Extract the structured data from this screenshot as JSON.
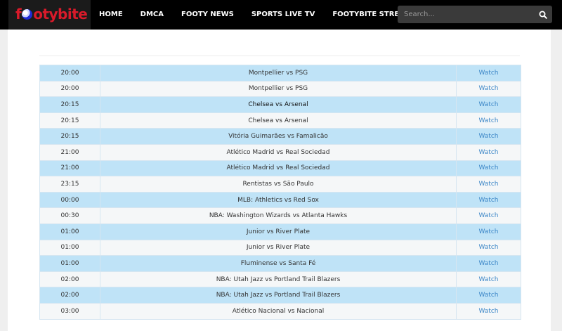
{
  "header": {
    "logo_text_prefix": "f",
    "logo_text_suffix": "otybite",
    "nav": [
      "HOME",
      "DMCA",
      "FOOTY NEWS",
      "SPORTS LIVE TV",
      "FOOTYBITE STREAM"
    ],
    "search_placeholder": "Search...",
    "colors": {
      "logo": "#d91a2a",
      "bar": "#000000"
    }
  },
  "schedule": {
    "watch_label": "Watch",
    "rows": [
      {
        "time": "20:00",
        "match": "Montpellier vs PSG"
      },
      {
        "time": "20:00",
        "match": "Montpellier vs PSG"
      },
      {
        "time": "20:15",
        "match": "Chelsea vs Arsenal"
      },
      {
        "time": "20:15",
        "match": "Chelsea vs Arsenal"
      },
      {
        "time": "20:15",
        "match": "Vitória Guimarães vs Famalicão"
      },
      {
        "time": "21:00",
        "match": "Atlético Madrid vs Real Sociedad"
      },
      {
        "time": "21:00",
        "match": "Atlético Madrid vs Real Sociedad"
      },
      {
        "time": "23:15",
        "match": "Rentistas vs São Paulo"
      },
      {
        "time": "00:00",
        "match": "MLB: Athletics vs Red Sox"
      },
      {
        "time": "00:30",
        "match": "NBA: Washington Wizards vs Atlanta Hawks"
      },
      {
        "time": "01:00",
        "match": "Junior vs River Plate"
      },
      {
        "time": "01:00",
        "match": "Junior vs River Plate"
      },
      {
        "time": "01:00",
        "match": "Fluminense vs Santa Fé"
      },
      {
        "time": "02:00",
        "match": "NBA: Utah Jazz vs Portland Trail Blazers"
      },
      {
        "time": "02:00",
        "match": "NBA: Utah Jazz vs Portland Trail Blazers"
      },
      {
        "time": "03:00",
        "match": "Atlético Nacional vs Nacional"
      }
    ]
  }
}
